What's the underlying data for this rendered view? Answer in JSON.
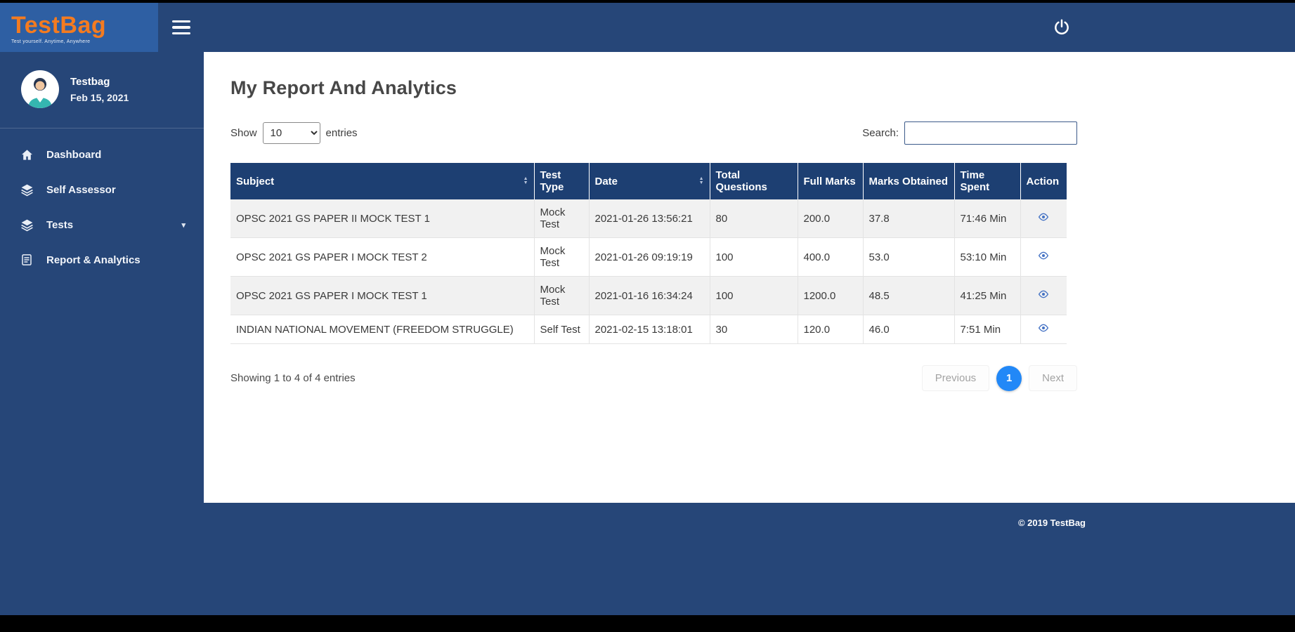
{
  "brand": {
    "name": "TestBag",
    "tagline": "Test yourself. Anytime, Anywhere",
    "copyright": "© 2019 TestBag"
  },
  "user": {
    "name": "Testbag",
    "date": "Feb 15, 2021"
  },
  "sidebar": {
    "items": [
      {
        "label": "Dashboard"
      },
      {
        "label": "Self Assessor"
      },
      {
        "label": "Tests"
      },
      {
        "label": "Report & Analytics"
      }
    ]
  },
  "main": {
    "title": "My Report And Analytics",
    "show_label": "Show",
    "entries_value": "10",
    "entries_label": "entries",
    "search_label": "Search:",
    "search_value": "",
    "info": "Showing 1 to 4 of 4 entries"
  },
  "table": {
    "headers": [
      "Subject",
      "Test Type",
      "Date",
      "Total Questions",
      "Full Marks",
      "Marks Obtained",
      "Time Spent",
      "Action"
    ],
    "rows": [
      {
        "subject": "OPSC 2021 GS PAPER II MOCK TEST 1",
        "test_type": "Mock Test",
        "date": "2021-01-26 13:56:21",
        "total_questions": "80",
        "full_marks": "200.0",
        "marks_obtained": "37.8",
        "time_spent": "71:46 Min"
      },
      {
        "subject": "OPSC 2021 GS PAPER I MOCK TEST 2",
        "test_type": "Mock Test",
        "date": "2021-01-26 09:19:19",
        "total_questions": "100",
        "full_marks": "400.0",
        "marks_obtained": "53.0",
        "time_spent": "53:10 Min"
      },
      {
        "subject": "OPSC 2021 GS PAPER I MOCK TEST 1",
        "test_type": "Mock Test",
        "date": "2021-01-16 16:34:24",
        "total_questions": "100",
        "full_marks": "1200.0",
        "marks_obtained": "48.5",
        "time_spent": "41:25 Min"
      },
      {
        "subject": "INDIAN NATIONAL MOVEMENT (FREEDOM STRUGGLE)",
        "test_type": "Self Test",
        "date": "2021-02-15 13:18:01",
        "total_questions": "30",
        "full_marks": "120.0",
        "marks_obtained": "46.0",
        "time_spent": "7:51 Min"
      }
    ]
  },
  "pagination": {
    "previous": "Previous",
    "page": "1",
    "next": "Next"
  },
  "colors": {
    "navy": "#264678",
    "logo_block": "#2e5fa3",
    "table_header": "#1d3f72",
    "orange": "#f47b20",
    "active_page": "#2288f7",
    "row_stripe": "#f1f1f1"
  }
}
